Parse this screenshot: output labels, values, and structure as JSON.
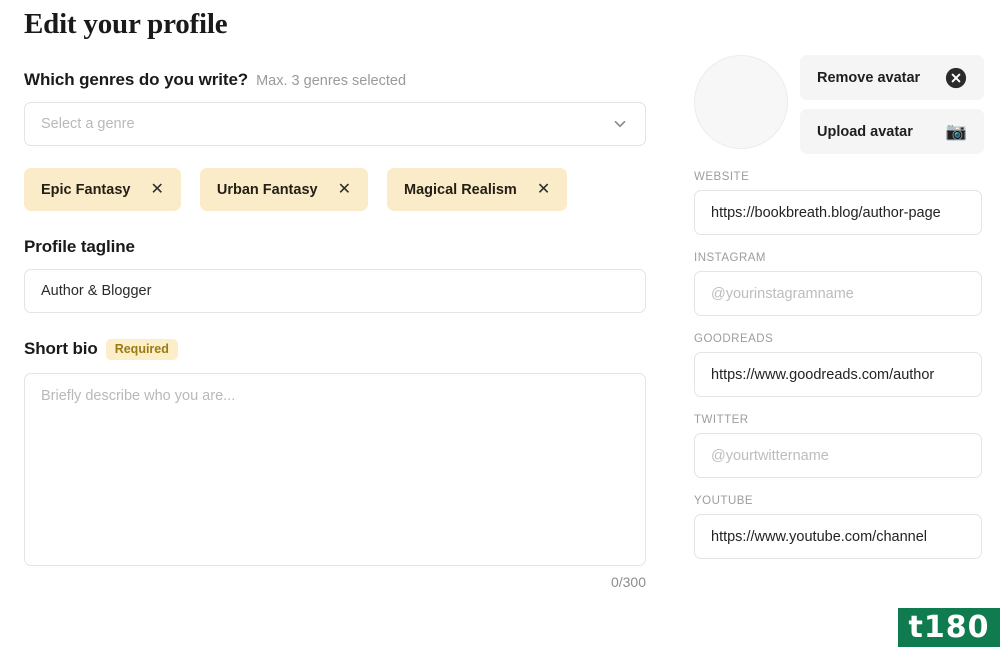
{
  "page": {
    "title": "Edit your profile"
  },
  "genres": {
    "label": "Which genres do you write?",
    "hint": "Max. 3 genres selected",
    "select_placeholder": "Select a genre",
    "chevron_icon": "chevron-down-icon",
    "tags": [
      {
        "label": "Epic Fantasy",
        "remove_icon": "close-icon"
      },
      {
        "label": "Urban Fantasy",
        "remove_icon": "close-icon"
      },
      {
        "label": "Magical Realism",
        "remove_icon": "close-icon"
      }
    ]
  },
  "tagline": {
    "label": "Profile tagline",
    "value": "Author & Blogger",
    "placeholder": ""
  },
  "bio": {
    "label": "Short bio",
    "badge": "Required",
    "placeholder": "Briefly describe who you are...",
    "value": "",
    "counter": "0/300"
  },
  "avatar": {
    "placeholder_name": "avatar-placeholder",
    "remove_label": "Remove avatar",
    "remove_icon": "close-circle-icon",
    "upload_label": "Upload avatar",
    "upload_icon": "camera-icon"
  },
  "social": [
    {
      "key": "website",
      "label": "WEBSITE",
      "value": "https://bookbreath.blog/author-page",
      "placeholder": ""
    },
    {
      "key": "instagram",
      "label": "INSTAGRAM",
      "value": "",
      "placeholder": "@yourinstagramname"
    },
    {
      "key": "goodreads",
      "label": "GOODREADS",
      "value": "https://www.goodreads.com/author",
      "placeholder": ""
    },
    {
      "key": "twitter",
      "label": "TWITTER",
      "value": "",
      "placeholder": "@yourtwittername"
    },
    {
      "key": "youtube",
      "label": "YOUTUBE",
      "value": "https://www.youtube.com/channel",
      "placeholder": ""
    }
  ],
  "watermark": {
    "text": "t180",
    "color": "#0f7b4e"
  },
  "colors": {
    "tag_background": "#faecc8",
    "badge_background": "#fbeec9",
    "badge_text": "#9a7b16",
    "button_background": "#f5f5f5",
    "border": "#e4e4e4"
  }
}
